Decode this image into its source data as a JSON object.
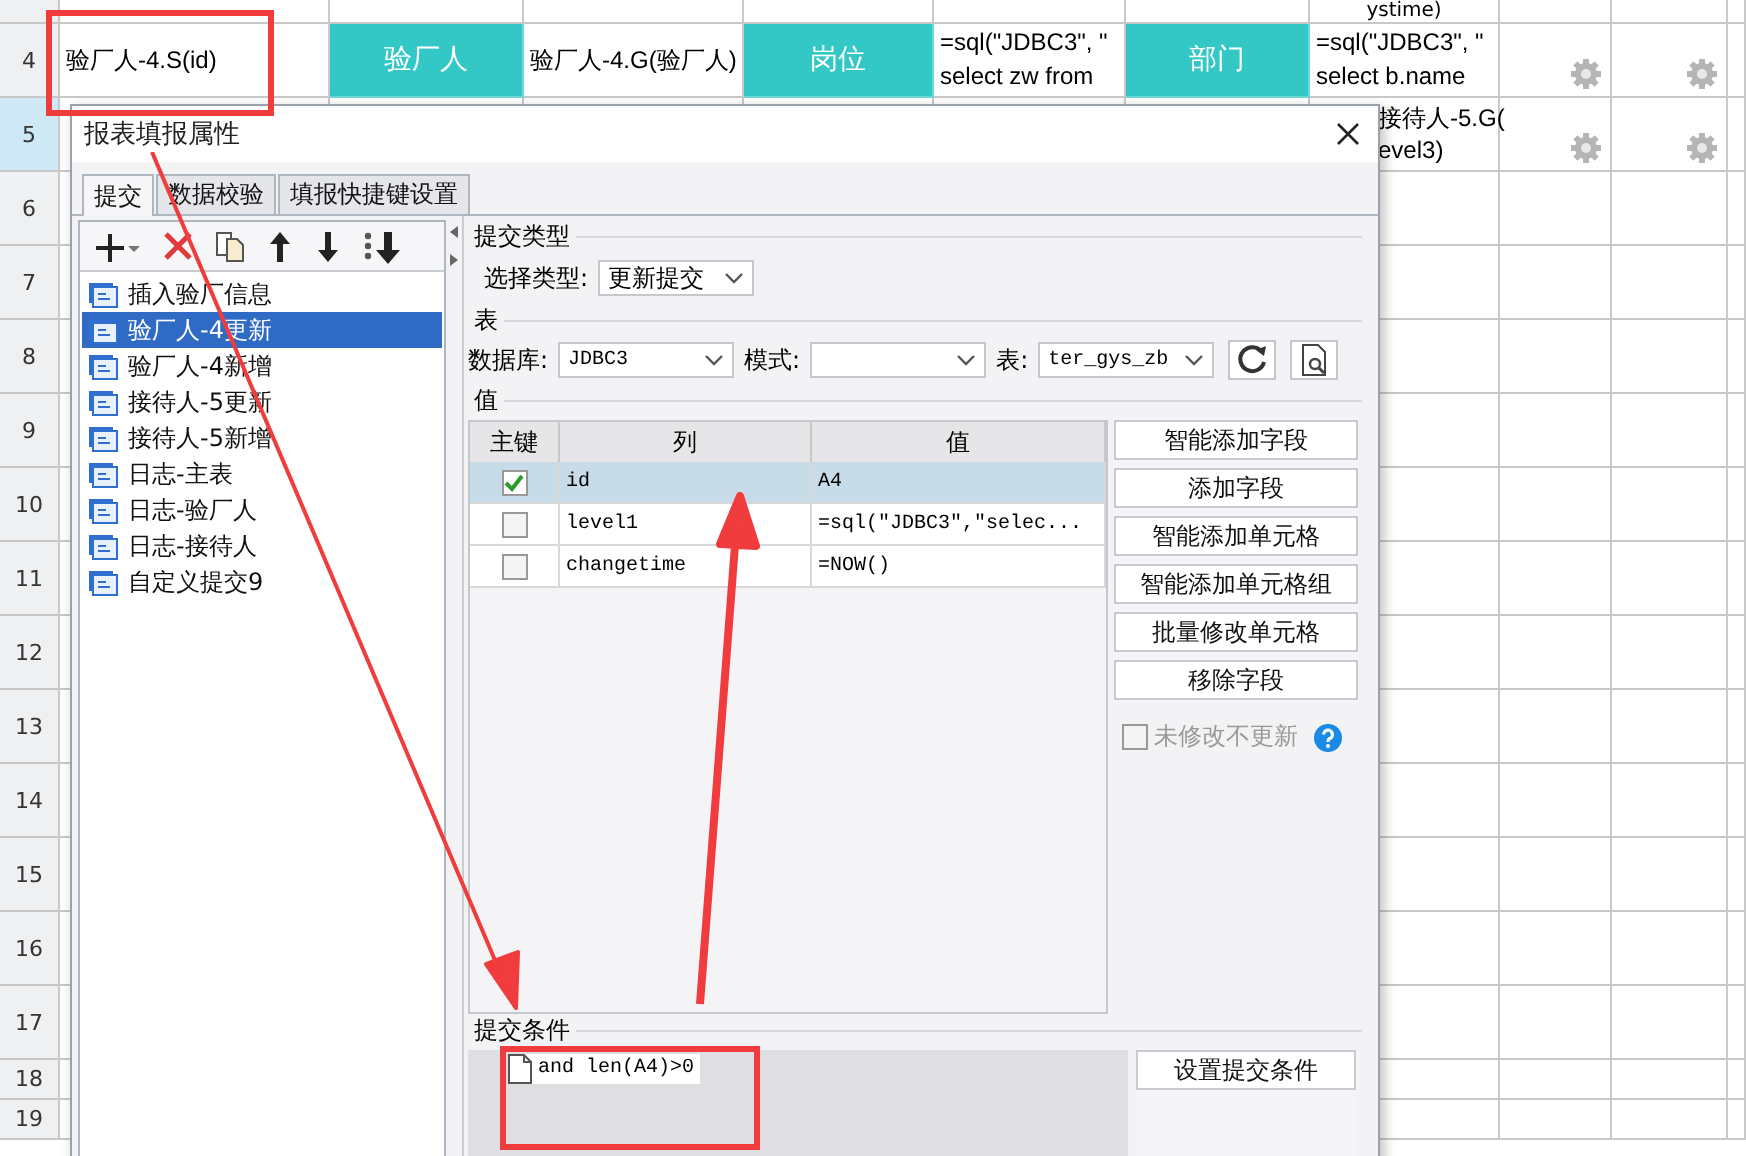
{
  "sheet": {
    "top_fragment": "ystime)",
    "rows": [
      {
        "number": "4",
        "selected": false,
        "cells": [
          {
            "kind": "text",
            "text": "验厂人-4.S(id)"
          },
          {
            "kind": "header",
            "text": "验厂人"
          },
          {
            "kind": "text",
            "text": "验厂人-4.G(验厂人)"
          },
          {
            "kind": "header",
            "text": "岗位"
          },
          {
            "kind": "text",
            "text": "=sql(\"JDBC3\", \"\nselect zw from"
          },
          {
            "kind": "header",
            "text": "部门"
          },
          {
            "kind": "text",
            "text": "=sql(\"JDBC3\", \"\nselect b.name"
          },
          {
            "kind": "gear"
          },
          {
            "kind": "gear"
          }
        ]
      },
      {
        "number": "5",
        "selected": true,
        "cells": [
          {
            "kind": "blank"
          },
          {
            "kind": "blank"
          },
          {
            "kind": "blank"
          },
          {
            "kind": "blank"
          },
          {
            "kind": "blank"
          },
          {
            "kind": "blank"
          },
          {
            "kind": "edge",
            "text": "接待人-5.G(\nevel3)"
          },
          {
            "kind": "gear"
          },
          {
            "kind": "gear"
          }
        ]
      },
      {
        "number": "6",
        "selected": false
      },
      {
        "number": "7",
        "selected": false
      },
      {
        "number": "8",
        "selected": false
      },
      {
        "number": "9",
        "selected": false
      },
      {
        "number": "10",
        "selected": false
      },
      {
        "number": "11",
        "selected": false
      },
      {
        "number": "12",
        "selected": false
      },
      {
        "number": "13",
        "selected": false
      },
      {
        "number": "14",
        "selected": false
      },
      {
        "number": "15",
        "selected": false
      },
      {
        "number": "16",
        "selected": false
      },
      {
        "number": "17",
        "selected": false
      },
      {
        "number": "18",
        "selected": false
      },
      {
        "number": "19",
        "selected": false
      }
    ]
  },
  "dialog": {
    "title": "报表填报属性",
    "tabs": [
      {
        "label": "提交",
        "selected": true
      },
      {
        "label": "数据校验",
        "selected": false
      },
      {
        "label": "填报快捷键设置",
        "selected": false
      }
    ],
    "submissions": [
      {
        "label": "插入验厂信息",
        "selected": false
      },
      {
        "label": "验厂人-4更新",
        "selected": true
      },
      {
        "label": "验厂人-4新增",
        "selected": false
      },
      {
        "label": "接待人-5更新",
        "selected": false
      },
      {
        "label": "接待人-5新增",
        "selected": false
      },
      {
        "label": "日志-主表",
        "selected": false
      },
      {
        "label": "日志-验厂人",
        "selected": false
      },
      {
        "label": "日志-接待人",
        "selected": false
      },
      {
        "label": "自定义提交9",
        "selected": false
      }
    ],
    "submit_type": {
      "label": "提交类型",
      "field_label": "选择类型:",
      "value": "更新提交"
    },
    "table_section": {
      "label": "表",
      "database": {
        "label": "数据库:",
        "value": "JDBC3"
      },
      "schema": {
        "label": "模式:"
      },
      "table": {
        "label": "表:",
        "value": "ter_gys_zb"
      }
    },
    "values": {
      "label": "值",
      "columns": [
        "主键",
        "列",
        "值"
      ],
      "rows": [
        {
          "primary_key": true,
          "column": "id",
          "value": "A4",
          "selected": true
        },
        {
          "primary_key": false,
          "column": "level1",
          "value": "=sql(\"JDBC3\",\"selec...",
          "selected": false
        },
        {
          "primary_key": false,
          "column": "changetime",
          "value": "=NOW()",
          "selected": false
        }
      ],
      "buttons": [
        "智能添加字段",
        "添加字段",
        "智能添加单元格",
        "智能添加单元格组",
        "批量修改单元格",
        "移除字段"
      ],
      "unchanged_option": {
        "label": "未修改不更新",
        "checked": false,
        "disabled": true
      }
    },
    "condition": {
      "label": "提交条件",
      "items": [
        "and len(A4)>0"
      ],
      "button": "设置提交条件"
    }
  }
}
